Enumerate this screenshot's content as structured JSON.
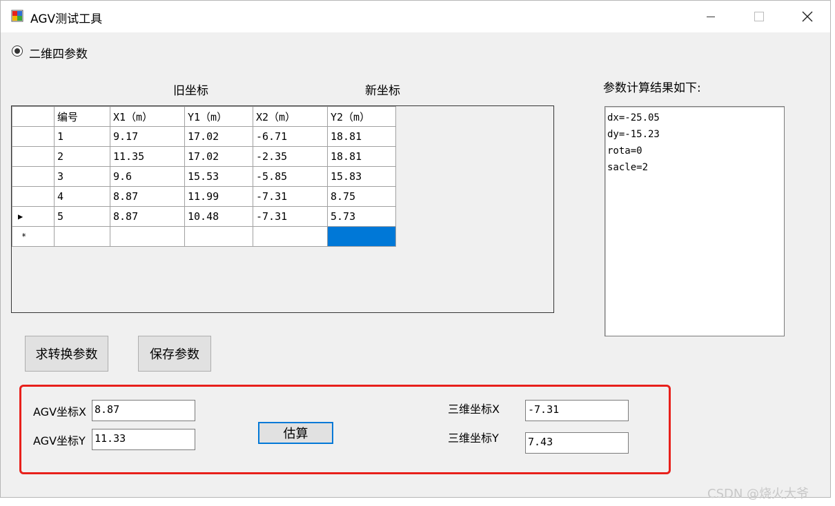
{
  "window": {
    "title": "AGV测试工具",
    "min_icon": "minimize-icon",
    "max_icon": "maximize-icon",
    "close_icon": "close-icon"
  },
  "radio": {
    "label": "二维四参数",
    "checked": true
  },
  "headers": {
    "old": "旧坐标",
    "new": "新坐标",
    "result_title": "参数计算结果如下:"
  },
  "grid": {
    "columns": [
      "编号",
      "X1（m）",
      "Y1（m）",
      "X2（m）",
      "Y2（m）"
    ],
    "rows": [
      [
        "1",
        "9.17",
        "17.02",
        "-6.71",
        "18.81"
      ],
      [
        "2",
        "11.35",
        "17.02",
        "-2.35",
        "18.81"
      ],
      [
        "3",
        "9.6",
        "15.53",
        "-5.85",
        "15.83"
      ],
      [
        "4",
        "8.87",
        "11.99",
        "-7.31",
        "8.75"
      ],
      [
        "5",
        "8.87",
        "10.48",
        "-7.31",
        "5.73"
      ]
    ],
    "current_row_marker": "▶",
    "new_row_marker": "*"
  },
  "results": [
    "dx=-25.05",
    "dy=-15.23",
    "rota=0",
    "sacle=2"
  ],
  "buttons": {
    "compute": "求转换参数",
    "save": "保存参数",
    "estimate": "估算"
  },
  "estimate": {
    "agv_x_label": "AGV坐标X",
    "agv_x_value": "8.87",
    "agv_y_label": "AGV坐标Y",
    "agv_y_value": "11.33",
    "map_x_label": "三维坐标X",
    "map_x_value": "-7.31",
    "map_y_label": "三维坐标Y",
    "map_y_value": "7.43"
  },
  "watermark": "CSDN @烧火大爷",
  "colors": {
    "highlight": "#e8201b",
    "selection": "#0078d7"
  }
}
